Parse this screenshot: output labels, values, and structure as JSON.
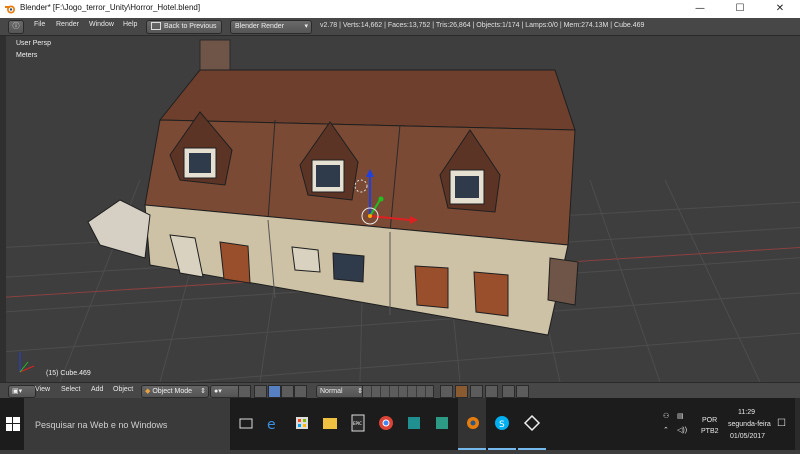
{
  "window": {
    "title": "Blender* [F:\\Jogo_terror_Unity\\Horror_Hotel.blend]",
    "minimize": "—",
    "maximize": "☐",
    "close": "✕"
  },
  "info_header": {
    "menus": [
      "File",
      "Render",
      "Window",
      "Help"
    ],
    "back_button": "Back to Previous",
    "engine": "Blender Render",
    "stats": "v2.78 | Verts:14,662 | Faces:13,752 | Tris:26,864 | Objects:1/174 | Lamps:0/0 | Mem:274.13M | Cube.469"
  },
  "viewport": {
    "view_name": "User Persp",
    "units": "Meters",
    "object_label": "(15) Cube.469"
  },
  "view3d_header": {
    "menus": [
      "View",
      "Select",
      "Add",
      "Object"
    ],
    "mode": "Object Mode",
    "shading": "Normal"
  },
  "taskbar": {
    "search_placeholder": "Pesquisar na Web e no Windows",
    "language": "POR",
    "layout": "PTB2",
    "time": "11:29",
    "weekday": "segunda-feira",
    "date": "01/05/2017",
    "apps": [
      "task-view",
      "edge",
      "store",
      "file-explorer",
      "epic-games",
      "chrome",
      "unknown-app",
      "unknown-app-2",
      "blender",
      "skype",
      "unity"
    ]
  },
  "colors": {
    "roof": "#7a4a35",
    "wall": "#cdc2a6",
    "viewport_bg": "#3e3e3e",
    "taskbar_bg": "#1c1c1c",
    "accent": "#76b9ed"
  }
}
